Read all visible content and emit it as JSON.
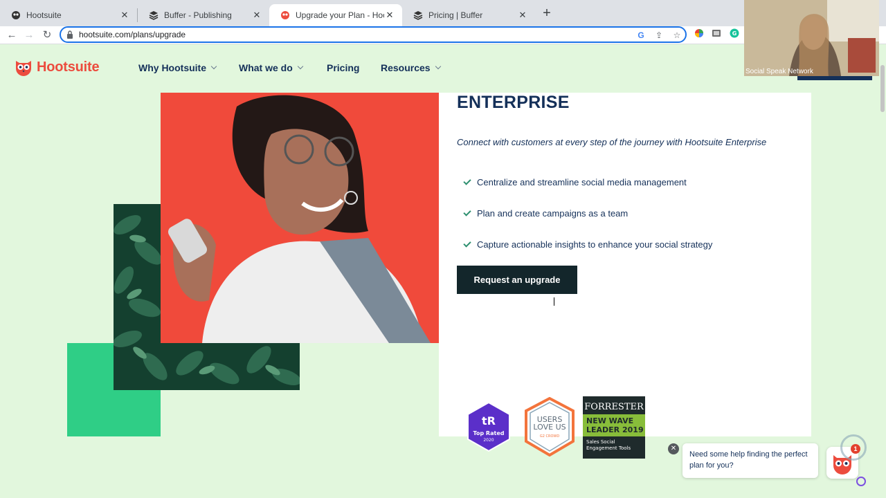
{
  "browser": {
    "tabs": [
      {
        "title": "Hootsuite",
        "icon": "owl-icon",
        "active": false
      },
      {
        "title": "Buffer - Publishing",
        "icon": "buffer-icon",
        "active": false
      },
      {
        "title": "Upgrade your Plan - Hootsuite",
        "icon": "owl-icon",
        "active": true
      },
      {
        "title": "Pricing | Buffer",
        "icon": "buffer-icon",
        "active": false
      }
    ],
    "new_tab": "+",
    "url": "hootsuite.com/plans/upgrade",
    "accent": "#1a73e8"
  },
  "site": {
    "brand": "Hootsuite",
    "brand_color": "#ec4c3e",
    "nav": [
      {
        "label": "Why Hootsuite",
        "has_dropdown": true
      },
      {
        "label": "What we do",
        "has_dropdown": true
      },
      {
        "label": "Pricing",
        "has_dropdown": false
      },
      {
        "label": "Resources",
        "has_dropdown": true
      }
    ]
  },
  "plan": {
    "title": "ENTERPRISE",
    "tagline": "Connect with customers at every step of the journey with Hootsuite Enterprise",
    "features": [
      "Centralize and streamline social media management",
      "Plan and create campaigns as a team",
      "Capture actionable insights to enhance your social strategy"
    ],
    "cta_label": "Request an upgrade"
  },
  "badges": {
    "trustradius": {
      "line1": "Top Rated",
      "line2": "2020"
    },
    "g2": {
      "line1": "USERS",
      "line2": "LOVE US",
      "line3": "G2 CROWD"
    },
    "forrester": {
      "brand": "FORRESTER",
      "line1": "NEW WAVE",
      "line2": "LEADER 2019",
      "line3": "Sales Social",
      "line4": "Engagement Tools"
    }
  },
  "chat": {
    "message": "Need some help finding the perfect plan for you?",
    "unread_count": "1"
  },
  "webcam": {
    "label": "Social Speak Network"
  }
}
